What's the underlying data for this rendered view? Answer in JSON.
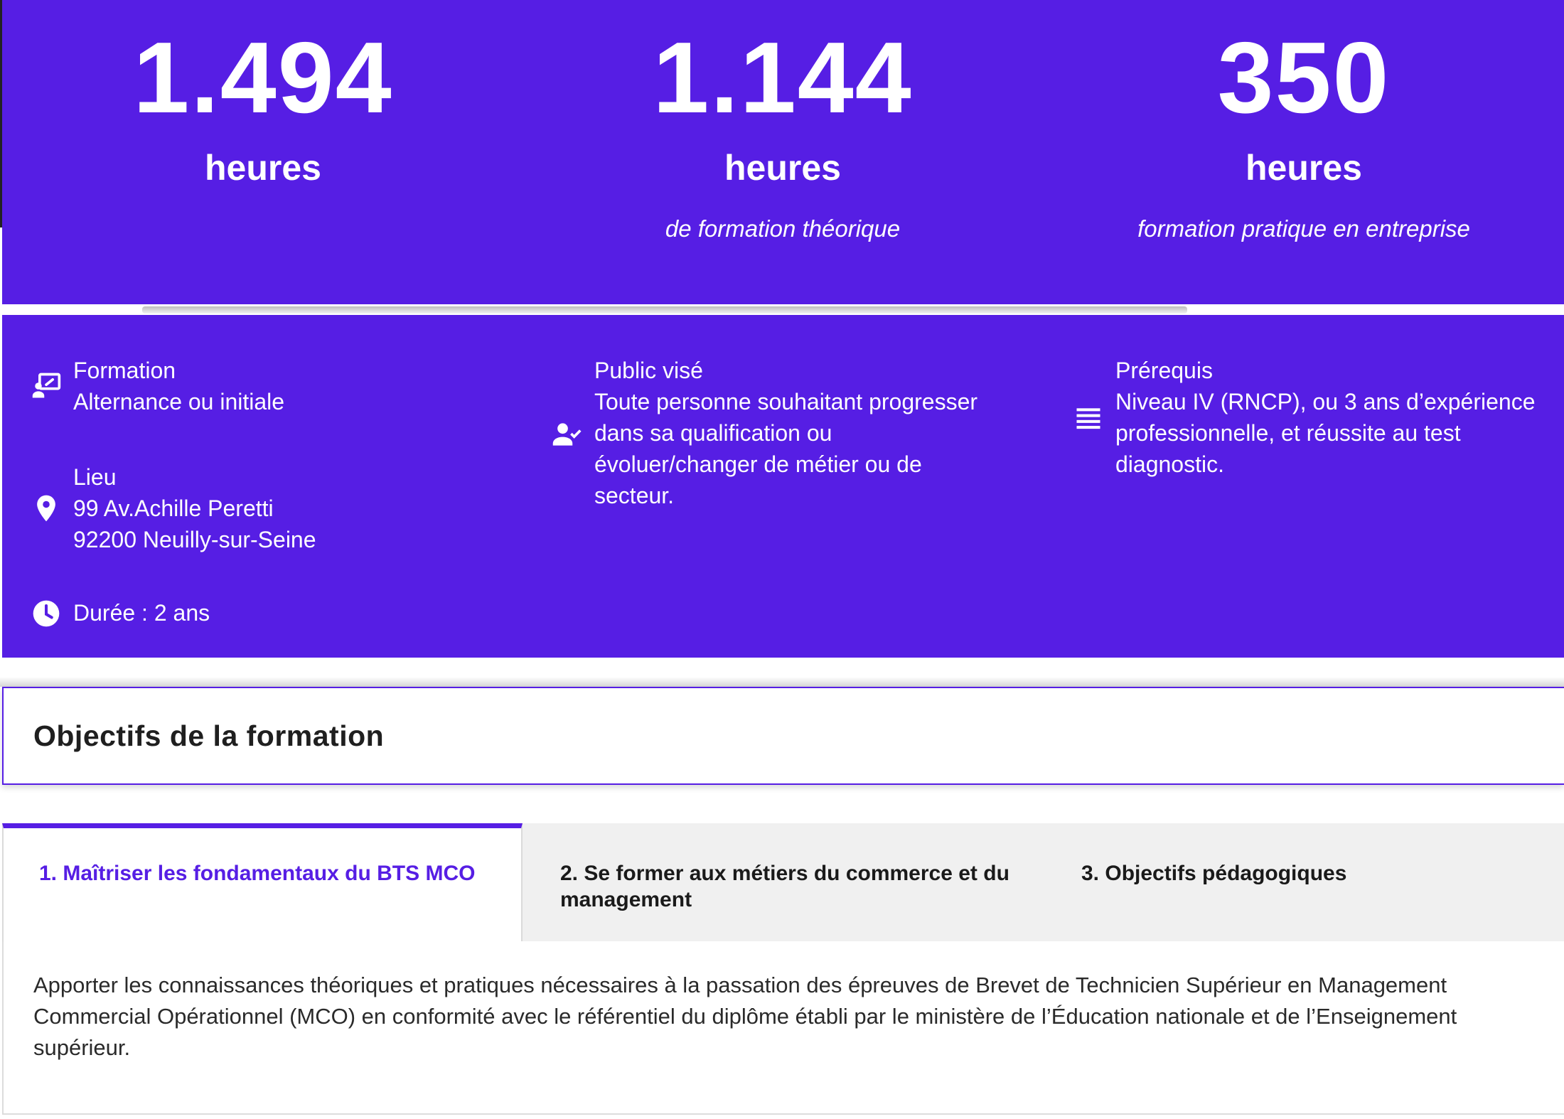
{
  "stats": [
    {
      "number": "1.494",
      "unit": "heures",
      "caption": ""
    },
    {
      "number": "1.144",
      "unit": "heures",
      "caption": "de formation théorique"
    },
    {
      "number": "350",
      "unit": "heures",
      "caption": "formation pratique en entreprise"
    }
  ],
  "info": {
    "formation": {
      "title": "Formation",
      "value": "Alternance ou initiale",
      "icon": "classroom-icon"
    },
    "lieu": {
      "title": "Lieu",
      "line1": "99 Av.Achille Peretti",
      "line2": "92200 Neuilly-sur-Seine",
      "icon": "map-pin-icon"
    },
    "duree": {
      "text": "Durée : 2 ans",
      "icon": "clock-icon"
    },
    "public": {
      "title": "Public visé",
      "lines": [
        "Toute personne souhaitant progresser",
        "dans sa qualification ou",
        "évoluer/changer de métier ou de",
        "secteur."
      ],
      "icon": "user-check-icon"
    },
    "prerequis": {
      "title": "Prérequis",
      "lines": [
        "Niveau IV (RNCP), ou 3 ans d’expérience",
        "professionnelle, et réussite au test",
        "diagnostic."
      ],
      "icon": "list-icon"
    }
  },
  "objectives": {
    "title": "Objectifs de la formation",
    "tabs": [
      {
        "label": "1. Maîtriser les fondamentaux du BTS MCO",
        "active": true
      },
      {
        "label_line1": "2. Se former aux métiers du commerce et du",
        "label_line2": "management",
        "active": false
      },
      {
        "label": "3. Objectifs pédagogiques",
        "active": false
      }
    ],
    "panel_lines": [
      "Apporter les connaissances théoriques et pratiques nécessaires à la passation des épreuves de Brevet de Technicien Supérieur en Management",
      "Commercial Opérationnel (MCO) en conformité avec le référentiel du diplôme établi par le ministère de l’Éducation nationale et de l’Enseignement",
      "supérieur."
    ]
  },
  "colors": {
    "brand": "#561ee4",
    "tab_bg": "#f0f0f0",
    "text": "#2a2a2a"
  }
}
